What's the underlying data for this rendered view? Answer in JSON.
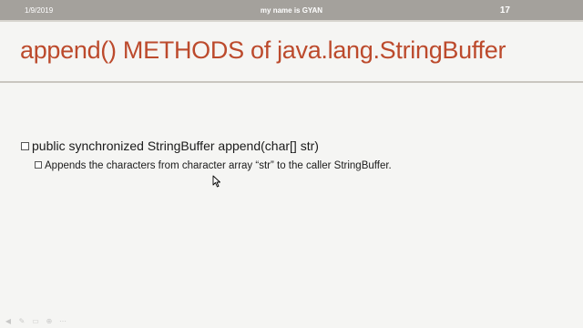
{
  "header": {
    "date": "1/9/2019",
    "center_text": "my name is GYAN",
    "page_number": "17"
  },
  "slide": {
    "title": "append() METHODS of java.lang.StringBuffer",
    "bullets": [
      {
        "text": "public synchronized StringBuffer append(char[] str)"
      },
      {
        "text": "Appends the characters from character array “str” to the caller StringBuffer."
      }
    ]
  },
  "colors": {
    "title": "#bc4a2c",
    "header_bar": "#a4a19c",
    "background": "#f5f5f3"
  },
  "icons": {
    "bullet": "square-bullet-icon",
    "cursor": "mouse-pointer-icon",
    "toolbar": [
      "previous-icon",
      "pen-icon",
      "slides-icon",
      "zoom-icon",
      "more-icon"
    ]
  }
}
